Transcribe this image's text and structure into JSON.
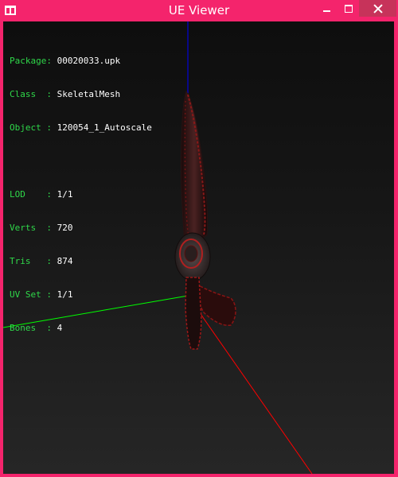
{
  "window": {
    "title": "UE Viewer",
    "frame_color": "#f4246c"
  },
  "info": {
    "package": {
      "label": "Package:",
      "value": "00020033.upk"
    },
    "class": {
      "label": "Class  :",
      "value": "SkeletalMesh"
    },
    "object": {
      "label": "Object :",
      "value": "120054_1_Autoscale"
    },
    "lod": {
      "label": "LOD    :",
      "value": "1/1"
    },
    "verts": {
      "label": "Verts  :",
      "value": "720"
    },
    "tris": {
      "label": "Tris   :",
      "value": "874"
    },
    "uvset": {
      "label": "UV Set :",
      "value": "1/1"
    },
    "bones": {
      "label": "Bones  :",
      "value": "4"
    }
  },
  "axes": {
    "x_color": "#ff0000",
    "y_color": "#00ff00",
    "z_color": "#0000ff"
  }
}
